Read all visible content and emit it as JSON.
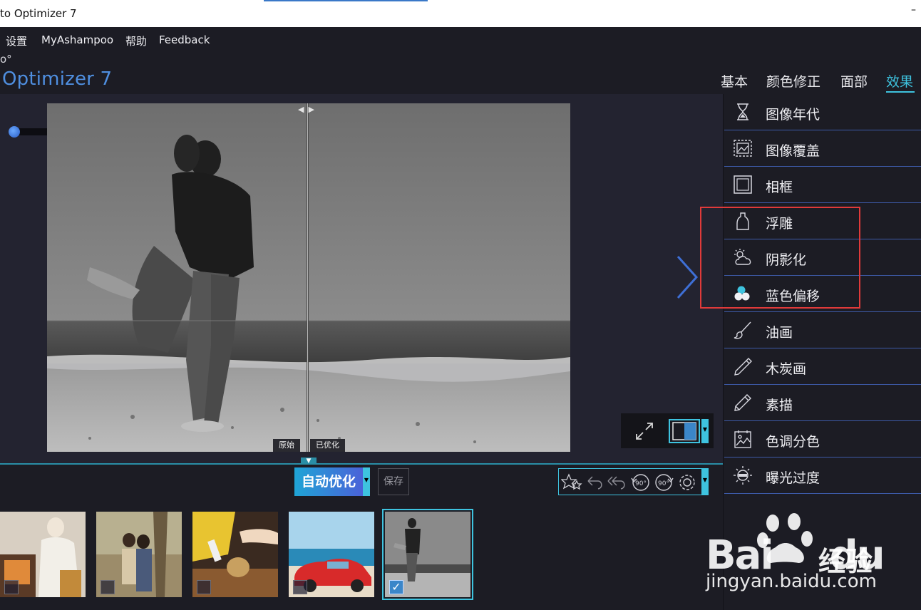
{
  "window": {
    "title": "to Optimizer 7"
  },
  "menu": {
    "items": [
      "设置",
      "MyAshampoo",
      "帮助",
      "Feedback"
    ]
  },
  "header": {
    "logo_sup": "o°",
    "logo": "Optimizer 7"
  },
  "tabs": [
    {
      "label": "基本",
      "active": false
    },
    {
      "label": "颜色修正",
      "active": false
    },
    {
      "label": "面部",
      "active": false
    },
    {
      "label": "效果",
      "active": true
    }
  ],
  "compare": {
    "original_label": "原始",
    "optimized_label": "已优化"
  },
  "actions": {
    "auto_optimize": "自动优化",
    "save": "保存"
  },
  "tools": [
    "star-icon",
    "undo-icon",
    "undo-all-icon",
    "rotate-left-90-icon",
    "rotate-right-90-icon",
    "settings-icon"
  ],
  "tools_labels": {
    "rotate_left": "90°",
    "rotate_right": "90°"
  },
  "effects": [
    {
      "label": "图像年代",
      "icon": "hourglass-icon"
    },
    {
      "label": "图像覆盖",
      "icon": "image-overlay-icon"
    },
    {
      "label": "相框",
      "icon": "frame-icon"
    },
    {
      "label": "浮雕",
      "icon": "emboss-icon"
    },
    {
      "label": "阴影化",
      "icon": "shadow-icon"
    },
    {
      "label": "蓝色偏移",
      "icon": "blue-shift-icon"
    },
    {
      "label": "油画",
      "icon": "oil-paint-brush-icon"
    },
    {
      "label": "木炭画",
      "icon": "charcoal-icon"
    },
    {
      "label": "素描",
      "icon": "sketch-pencil-icon"
    },
    {
      "label": "色调分色",
      "icon": "tone-split-icon"
    },
    {
      "label": "曝光过度",
      "icon": "overexposure-icon"
    }
  ],
  "thumbnails": [
    {
      "name": "kitchen-woman",
      "checked": false
    },
    {
      "name": "couple-tree",
      "checked": false
    },
    {
      "name": "baking-hands",
      "checked": false
    },
    {
      "name": "red-car-beach",
      "checked": false
    },
    {
      "name": "couple-beach-bw",
      "checked": true
    }
  ],
  "watermark": {
    "brand": "Bai",
    "brand2": "du",
    "cn": "经验",
    "url": "jingyan.baidu.com"
  },
  "colors": {
    "accent": "#3ec3df",
    "logo": "#4f8fe0",
    "highlight": "#e03a3a",
    "panel_divider": "#3d5aa8"
  }
}
